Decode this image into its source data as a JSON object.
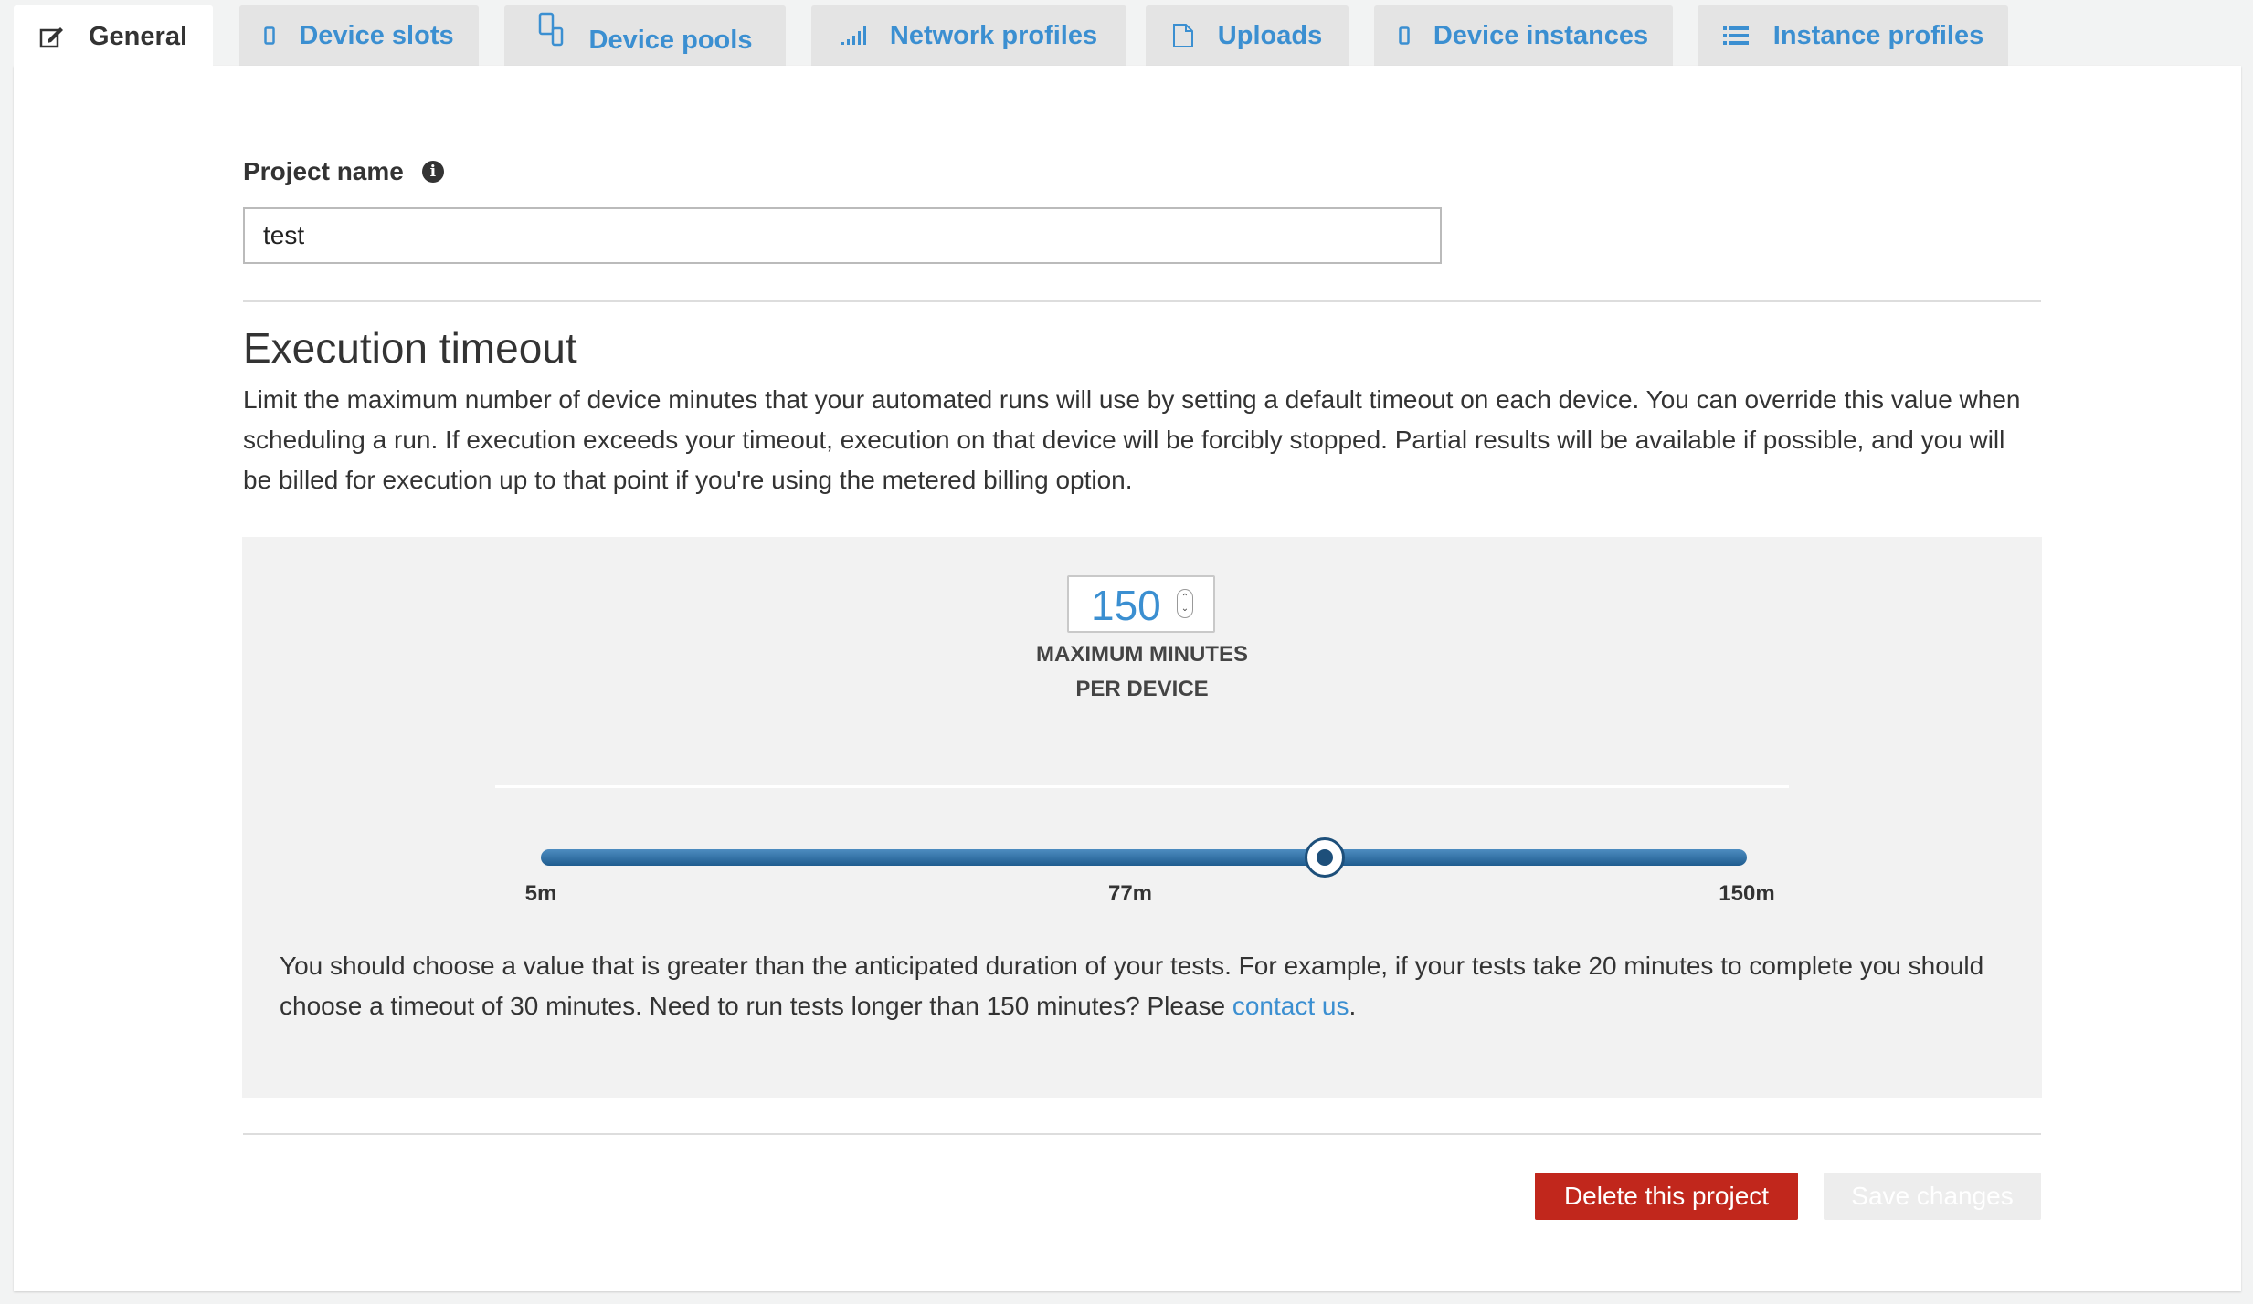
{
  "tabs": [
    {
      "label": "General",
      "icon": "edit-icon",
      "active": true
    },
    {
      "label": "Device slots",
      "icon": "mobile-device-icon"
    },
    {
      "label": "Device pools",
      "icon": "device-pool-icon"
    },
    {
      "label": "Network profiles",
      "icon": "signal-bars-icon"
    },
    {
      "label": "Uploads",
      "icon": "file-icon"
    },
    {
      "label": "Device instances",
      "icon": "mobile-device-icon"
    },
    {
      "label": "Instance profiles",
      "icon": "list-icon"
    }
  ],
  "project": {
    "label": "Project name",
    "value": "test"
  },
  "timeout": {
    "title": "Execution timeout",
    "description": "Limit the maximum number of device minutes that your automated runs will use by setting a default timeout on each device. You can override this value when scheduling a run. If execution exceeds your timeout, execution on that device will be forcibly stopped. Partial results will be available if possible, and you will be billed for execution up to that point if you're using the metered billing option.",
    "stepper_value": "150",
    "stepper_caption": "MAXIMUM MINUTES PER DEVICE",
    "slider": {
      "min_label": "5m",
      "mid_label": "77m",
      "max_label": "150m",
      "fraction": 0.65
    },
    "hint_text": "You should choose a value that is greater than the anticipated duration of your tests. For example, if your tests take 20 minutes to complete you should choose a timeout of 30 minutes. Need to run tests longer than 150 minutes? Please ",
    "hint_link": "contact us",
    "hint_end": "."
  },
  "actions": {
    "delete_label": "Delete this project",
    "save_label": "Save changes"
  },
  "colors": {
    "accent": "#3b8fd1",
    "danger": "#c1271c",
    "slider": "#1f5c8f"
  }
}
